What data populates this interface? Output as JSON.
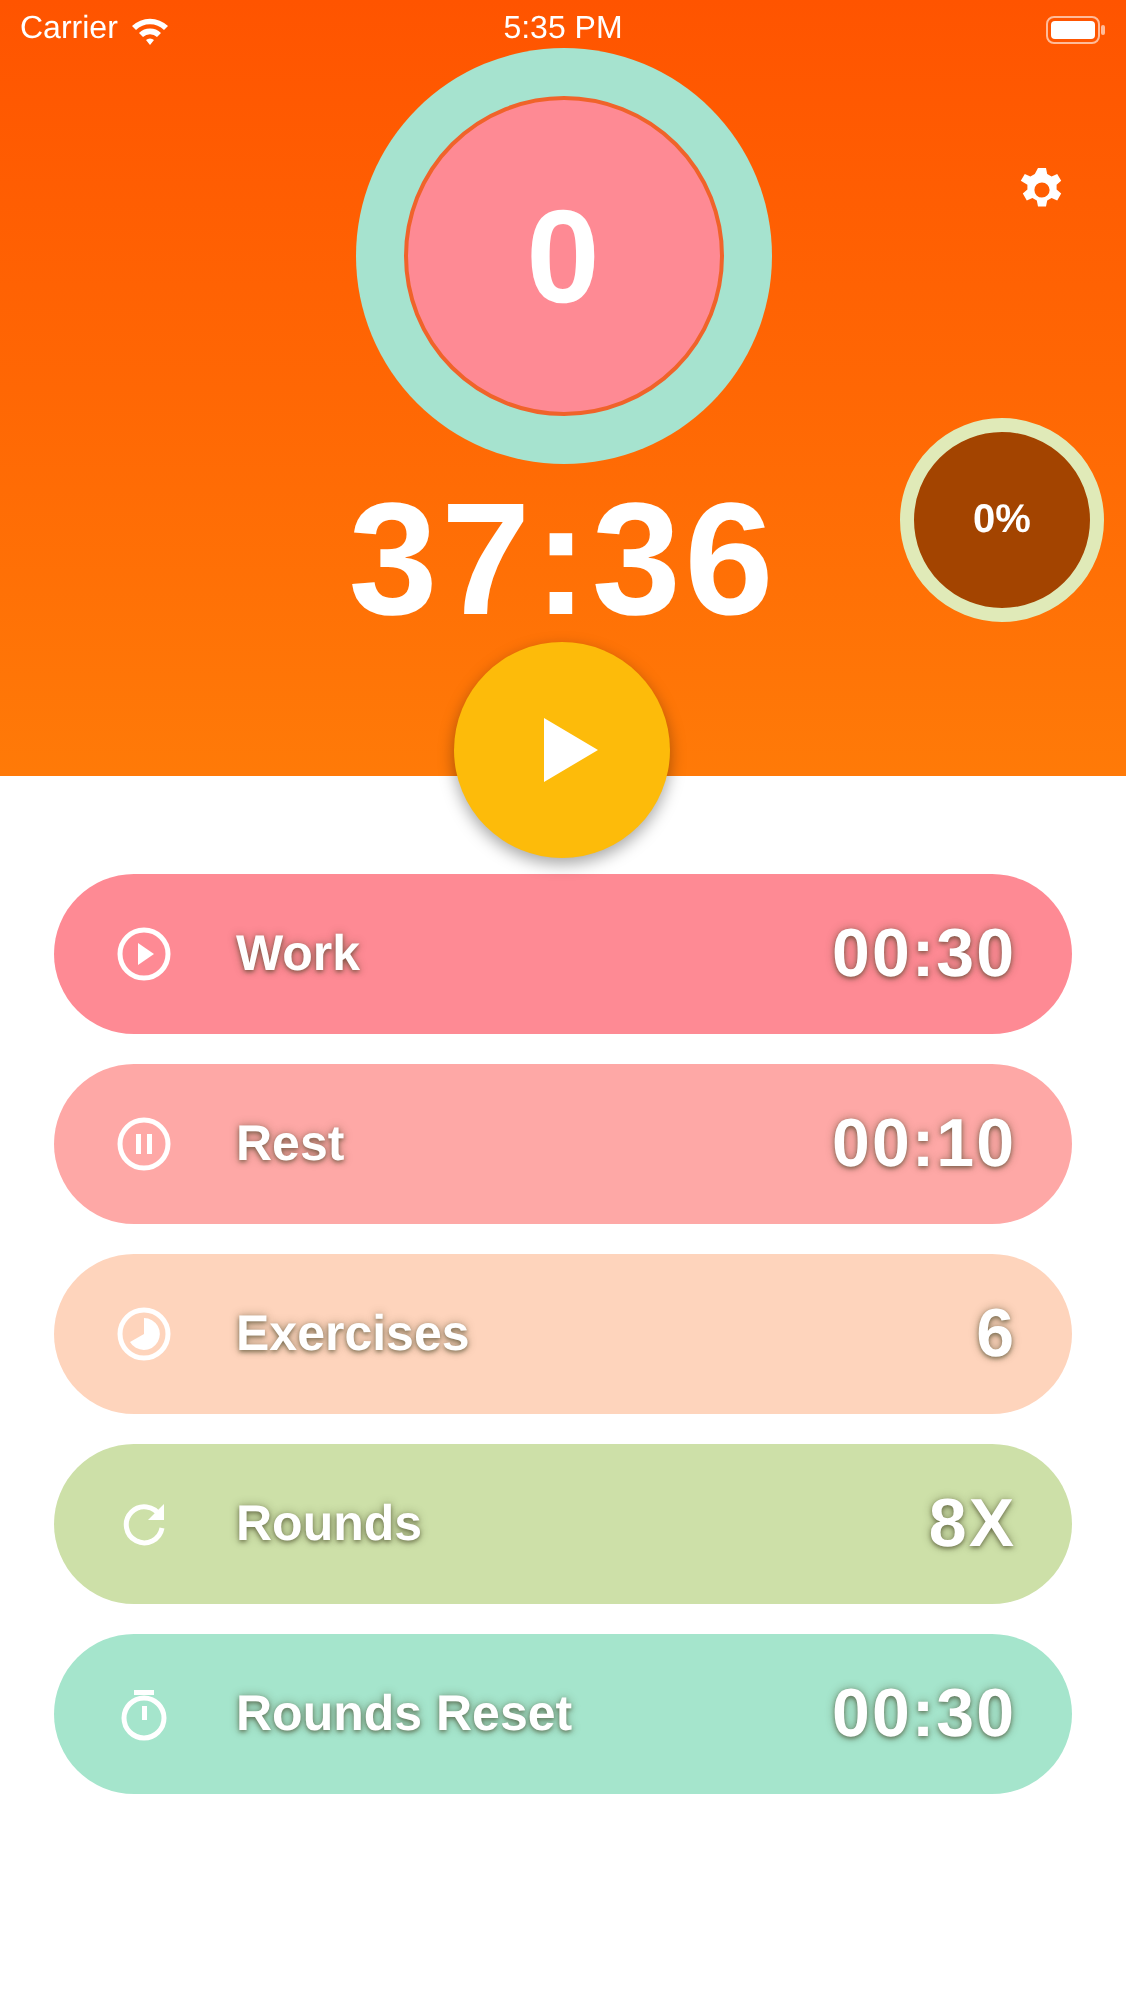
{
  "status_bar": {
    "carrier": "Carrier",
    "time": "5:35 PM"
  },
  "counter": "0",
  "timer": "37:36",
  "progress": "0%",
  "rows": [
    {
      "label": "Work",
      "value": "00:30",
      "color": "#fe8a94"
    },
    {
      "label": "Rest",
      "value": "00:10",
      "color": "#fea8a6"
    },
    {
      "label": "Exercises",
      "value": "6",
      "color": "#fed4bc"
    },
    {
      "label": "Rounds",
      "value": "8X",
      "color": "#cde0a8"
    },
    {
      "label": "Rounds Reset",
      "value": "00:30",
      "color": "#a5e5cc"
    }
  ]
}
